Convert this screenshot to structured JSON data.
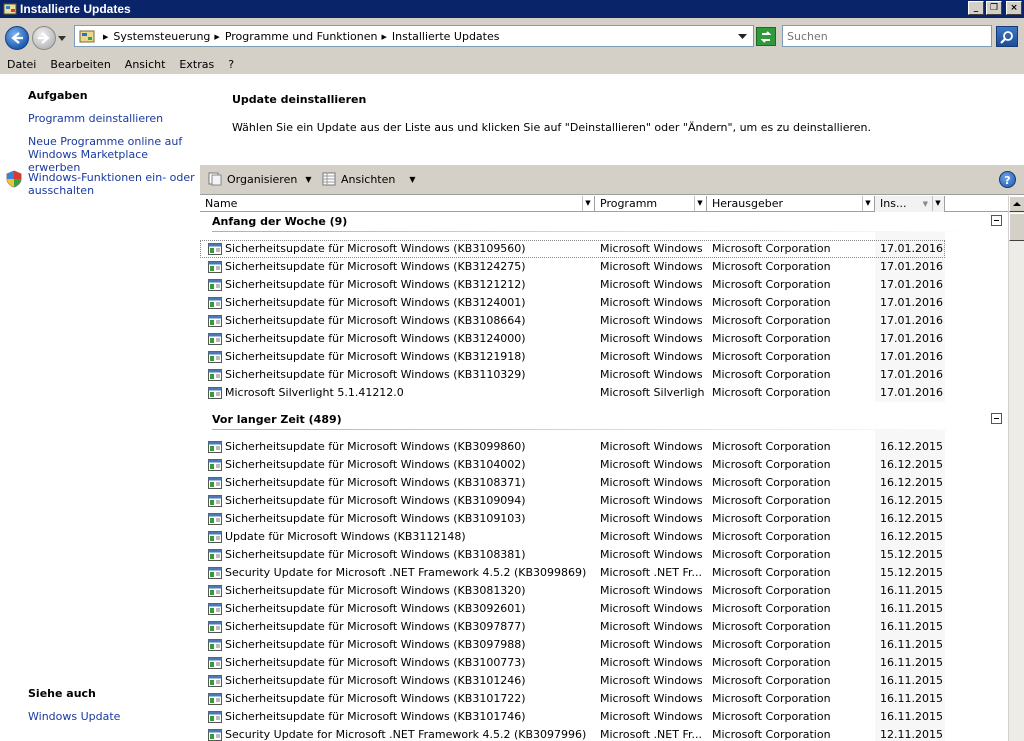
{
  "window": {
    "title": "Installierte Updates",
    "buttons": {
      "minimize": "_",
      "maximize": "❐",
      "close": "×"
    }
  },
  "address": {
    "crumbs": [
      "Systemsteuerung",
      "Programme und Funktionen",
      "Installierte Updates"
    ],
    "search_placeholder": "Suchen"
  },
  "menu": [
    "Datei",
    "Bearbeiten",
    "Ansicht",
    "Extras",
    "?"
  ],
  "sidebar": {
    "tasks_heading": "Aufgaben",
    "links": [
      "Programm deinstallieren",
      "Neue Programme online auf",
      "Windows Marketplace erwerben",
      "Windows-Funktionen ein- oder",
      "ausschalten"
    ],
    "see_also_heading": "Siehe auch",
    "see_also_link": "Windows Update"
  },
  "main": {
    "title": "Update deinstallieren",
    "description": "Wählen Sie ein Update aus der Liste aus und klicken Sie auf \"Deinstallieren\" oder \"Ändern\", um es zu deinstallieren."
  },
  "toolbar": {
    "organize": "Organisieren",
    "views": "Ansichten",
    "help": "?"
  },
  "columns": {
    "name": "Name",
    "program": "Programm",
    "publisher": "Herausgeber",
    "installed": "Ins..."
  },
  "groups": [
    {
      "title": "Anfang der Woche (9)",
      "rows": [
        [
          "Sicherheitsupdate für Microsoft Windows (KB3109560)",
          "Microsoft Windows",
          "Microsoft Corporation",
          "17.01.2016"
        ],
        [
          "Sicherheitsupdate für Microsoft Windows (KB3124275)",
          "Microsoft Windows",
          "Microsoft Corporation",
          "17.01.2016"
        ],
        [
          "Sicherheitsupdate für Microsoft Windows (KB3121212)",
          "Microsoft Windows",
          "Microsoft Corporation",
          "17.01.2016"
        ],
        [
          "Sicherheitsupdate für Microsoft Windows (KB3124001)",
          "Microsoft Windows",
          "Microsoft Corporation",
          "17.01.2016"
        ],
        [
          "Sicherheitsupdate für Microsoft Windows (KB3108664)",
          "Microsoft Windows",
          "Microsoft Corporation",
          "17.01.2016"
        ],
        [
          "Sicherheitsupdate für Microsoft Windows (KB3124000)",
          "Microsoft Windows",
          "Microsoft Corporation",
          "17.01.2016"
        ],
        [
          "Sicherheitsupdate für Microsoft Windows (KB3121918)",
          "Microsoft Windows",
          "Microsoft Corporation",
          "17.01.2016"
        ],
        [
          "Sicherheitsupdate für Microsoft Windows (KB3110329)",
          "Microsoft Windows",
          "Microsoft Corporation",
          "17.01.2016"
        ],
        [
          "Microsoft Silverlight 5.1.41212.0",
          "Microsoft Silverlight",
          "Microsoft Corporation",
          "17.01.2016"
        ]
      ]
    },
    {
      "title": "Vor langer Zeit (489)",
      "rows": [
        [
          "Sicherheitsupdate für Microsoft Windows (KB3099860)",
          "Microsoft Windows",
          "Microsoft Corporation",
          "16.12.2015"
        ],
        [
          "Sicherheitsupdate für Microsoft Windows (KB3104002)",
          "Microsoft Windows",
          "Microsoft Corporation",
          "16.12.2015"
        ],
        [
          "Sicherheitsupdate für Microsoft Windows (KB3108371)",
          "Microsoft Windows",
          "Microsoft Corporation",
          "16.12.2015"
        ],
        [
          "Sicherheitsupdate für Microsoft Windows (KB3109094)",
          "Microsoft Windows",
          "Microsoft Corporation",
          "16.12.2015"
        ],
        [
          "Sicherheitsupdate für Microsoft Windows (KB3109103)",
          "Microsoft Windows",
          "Microsoft Corporation",
          "16.12.2015"
        ],
        [
          "Update für Microsoft Windows (KB3112148)",
          "Microsoft Windows",
          "Microsoft Corporation",
          "16.12.2015"
        ],
        [
          "Sicherheitsupdate für Microsoft Windows (KB3108381)",
          "Microsoft Windows",
          "Microsoft Corporation",
          "15.12.2015"
        ],
        [
          "Security Update for Microsoft .NET Framework 4.5.2 (KB3099869)",
          "Microsoft .NET Fr...",
          "Microsoft Corporation",
          "15.12.2015"
        ],
        [
          "Sicherheitsupdate für Microsoft Windows (KB3081320)",
          "Microsoft Windows",
          "Microsoft Corporation",
          "16.11.2015"
        ],
        [
          "Sicherheitsupdate für Microsoft Windows (KB3092601)",
          "Microsoft Windows",
          "Microsoft Corporation",
          "16.11.2015"
        ],
        [
          "Sicherheitsupdate für Microsoft Windows (KB3097877)",
          "Microsoft Windows",
          "Microsoft Corporation",
          "16.11.2015"
        ],
        [
          "Sicherheitsupdate für Microsoft Windows (KB3097988)",
          "Microsoft Windows",
          "Microsoft Corporation",
          "16.11.2015"
        ],
        [
          "Sicherheitsupdate für Microsoft Windows (KB3100773)",
          "Microsoft Windows",
          "Microsoft Corporation",
          "16.11.2015"
        ],
        [
          "Sicherheitsupdate für Microsoft Windows (KB3101246)",
          "Microsoft Windows",
          "Microsoft Corporation",
          "16.11.2015"
        ],
        [
          "Sicherheitsupdate für Microsoft Windows (KB3101722)",
          "Microsoft Windows",
          "Microsoft Corporation",
          "16.11.2015"
        ],
        [
          "Sicherheitsupdate für Microsoft Windows (KB3101746)",
          "Microsoft Windows",
          "Microsoft Corporation",
          "16.11.2015"
        ],
        [
          "Security Update for Microsoft .NET Framework 4.5.2 (KB3097996)",
          "Microsoft .NET Fr...",
          "Microsoft Corporation",
          "12.11.2015"
        ]
      ]
    }
  ],
  "colors": {
    "titlebar": "#0a246a",
    "link": "#1a3a9e",
    "chrome": "#d4d0c8"
  }
}
